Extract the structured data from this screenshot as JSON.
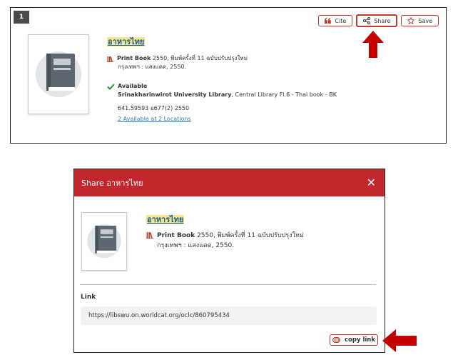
{
  "result": {
    "index": "1",
    "actions": {
      "cite": "Cite",
      "share": "Share",
      "save": "Save"
    },
    "title": "อาหารไทย",
    "format": "Print Book",
    "edition": "2550, พิมพ์ครั้งที่ 11 ฉบับปรับปรุงใหม่",
    "publisher": "กรุงเทพฯ : แสงแดด, 2550.",
    "availability": "Available",
    "library": "Srinakharinwirot University Library",
    "location": ", Central Library Fl.6 - Thai book - BK",
    "call_number": "641.59593 อ677(2) 2550",
    "locations_link": "2 Available at 2 Locations"
  },
  "share_modal": {
    "title": "Share อาหารไทย",
    "item_title": "อาหารไทย",
    "format": "Print Book",
    "edition": "2550, พิมพ์ครั้งที่ 11 ฉบับปรับปรุงใหม่",
    "publisher": "กรุงเทพฯ : แสงแดด, 2550.",
    "link_label": "Link",
    "link_url": "https://libswu.on.worldcat.org/oclc/860795434",
    "copy_button": "copy link"
  },
  "colors": {
    "accent_red": "#c1272d",
    "link_blue": "#1a5a96",
    "available_green": "#2e8b3a",
    "highlight": "#f6e78d"
  },
  "icons": {
    "cite": "quote-icon",
    "share": "share-icon",
    "save": "star-icon",
    "format": "book-shelf-icon",
    "available": "checkmark-icon",
    "close": "close-icon",
    "copy": "link-icon",
    "cover": "book-cover-icon"
  }
}
